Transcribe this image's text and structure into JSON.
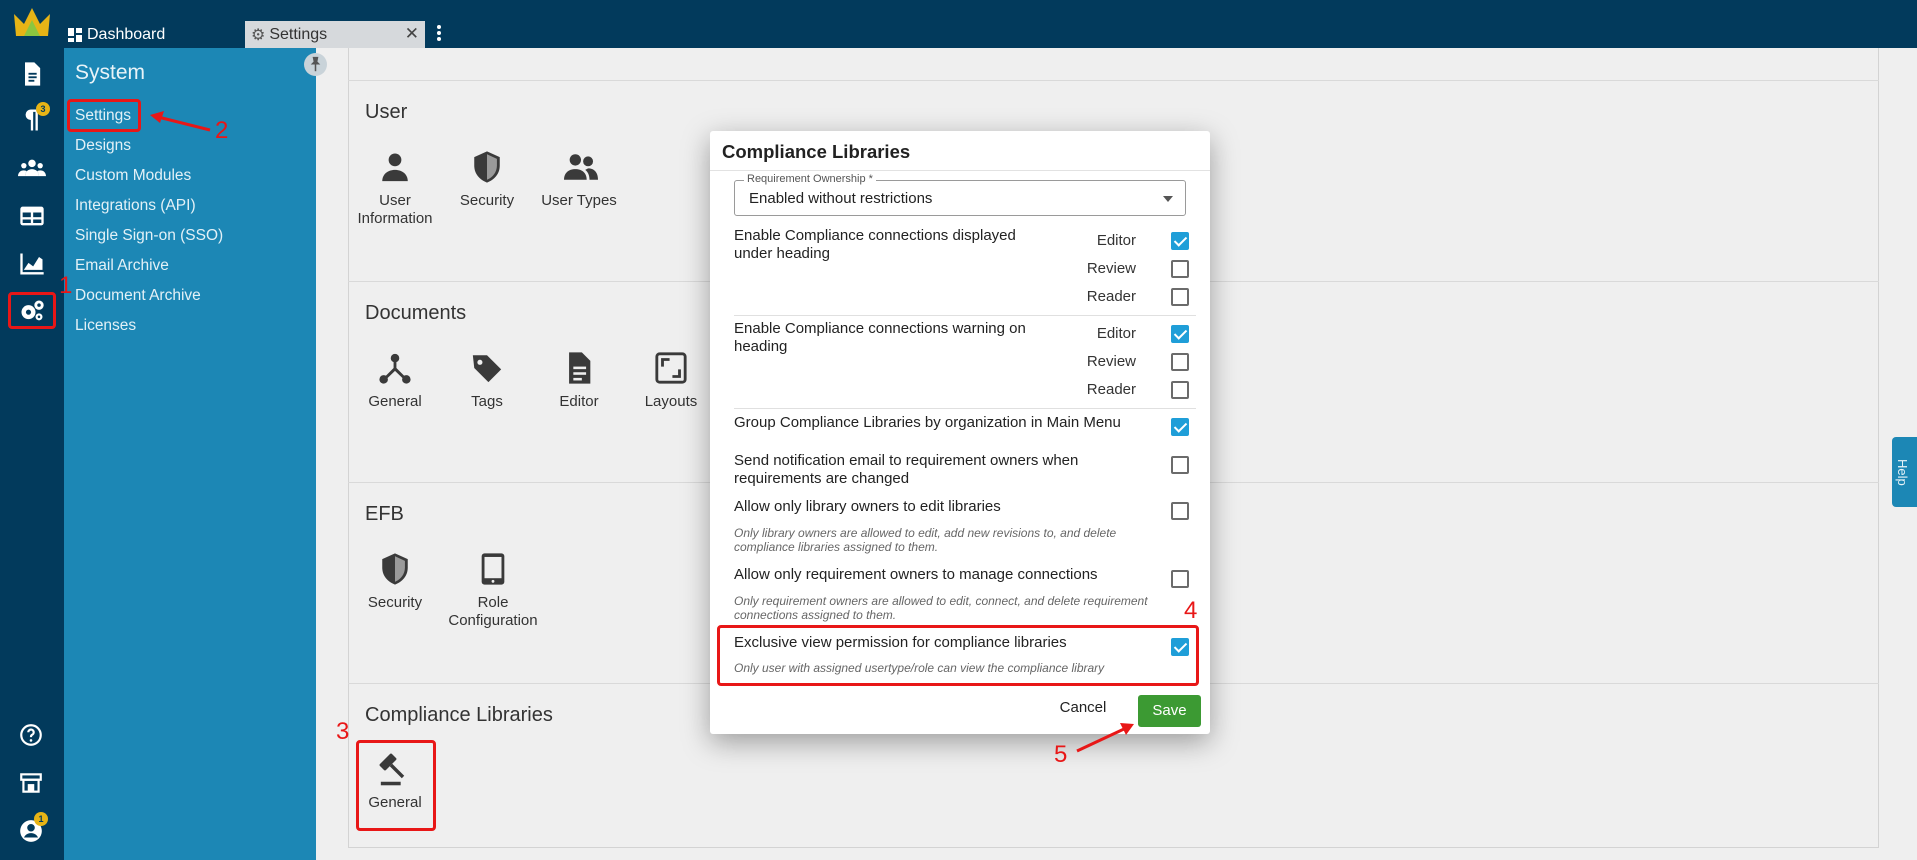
{
  "tabs": [
    {
      "label": "Dashboard"
    },
    {
      "label": "Settings"
    }
  ],
  "rail": {
    "notification_badge": "3",
    "user_badge": "1"
  },
  "system": {
    "title": "System",
    "items": [
      "Settings",
      "Designs",
      "Custom Modules",
      "Integrations (API)",
      "Single Sign-on (SSO)",
      "Email Archive",
      "Document Archive",
      "Licenses"
    ]
  },
  "sections": {
    "user": {
      "title": "User",
      "tiles": [
        "User\nInformation",
        "Security",
        "User Types"
      ]
    },
    "documents": {
      "title": "Documents",
      "tiles": [
        "General",
        "Tags",
        "Editor",
        "Layouts"
      ]
    },
    "efb": {
      "title": "EFB",
      "tiles": [
        "Security",
        "Role\nConfiguration"
      ]
    },
    "compliance": {
      "title": "Compliance Libraries",
      "tiles": [
        "General"
      ]
    }
  },
  "dialog": {
    "title": "Compliance Libraries",
    "requirement_ownership_label": "Requirement Ownership *",
    "requirement_ownership_value": "Enabled without restrictions",
    "role_labels": [
      "Editor",
      "Review",
      "Reader"
    ],
    "rows": [
      {
        "text": "Enable Compliance connections displayed\nunder heading",
        "roles": [
          true,
          false,
          false
        ]
      },
      {
        "text": "Enable Compliance connections warning on\nheading",
        "roles": [
          true,
          false,
          false
        ]
      },
      {
        "text": "Group Compliance Libraries by organization in Main Menu",
        "checked": true
      },
      {
        "text": "Send notification email to requirement owners when\nrequirements are changed",
        "checked": false
      },
      {
        "text": "Allow only library owners to edit libraries",
        "desc": "Only library owners are allowed to edit, add new revisions to, and delete\ncompliance libraries assigned to them.",
        "checked": false
      },
      {
        "text": "Allow only requirement owners to manage connections",
        "desc": "Only requirement owners are allowed to edit, connect, and delete requirement\nconnections assigned to them.",
        "checked": false
      },
      {
        "text": "Exclusive view permission for compliance libraries",
        "desc": "Only user with assigned usertype/role can view the compliance library",
        "checked": true
      }
    ],
    "cancel_label": "Cancel",
    "save_label": "Save"
  },
  "help_label": "Help",
  "annotations": [
    "1",
    "2",
    "3",
    "4",
    "5"
  ],
  "colors": {
    "accent": "#1c87b5",
    "topbar": "#023a5c",
    "save": "#3c9a33",
    "checkbox": "#1f9ed8",
    "annotation": "#e81717"
  }
}
